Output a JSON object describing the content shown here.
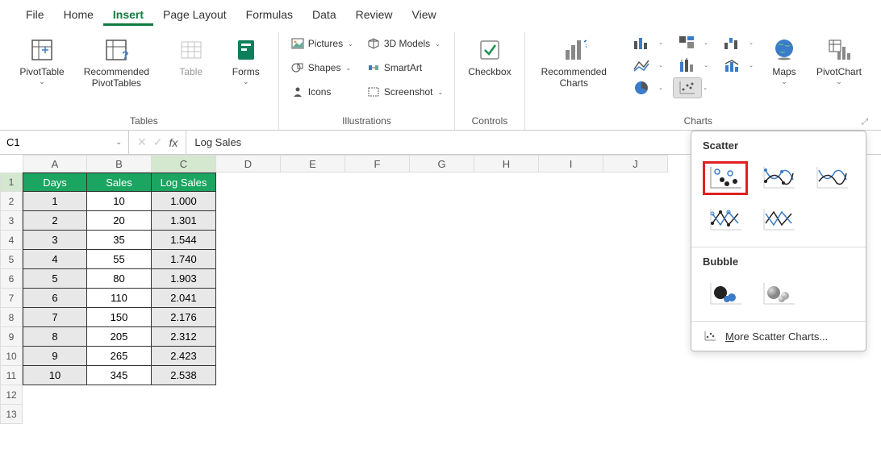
{
  "menu": {
    "tabs": [
      "File",
      "Home",
      "Insert",
      "Page Layout",
      "Formulas",
      "Data",
      "Review",
      "View"
    ],
    "active": "Insert"
  },
  "ribbon": {
    "tables": {
      "label": "Tables",
      "pivot": "PivotTable",
      "recpivot": "Recommended PivotTables",
      "table": "Table",
      "forms": "Forms"
    },
    "illustrations": {
      "label": "Illustrations",
      "pictures": "Pictures",
      "shapes": "Shapes",
      "icons": "Icons",
      "models": "3D Models",
      "smartart": "SmartArt",
      "screenshot": "Screenshot"
    },
    "controls": {
      "label": "Controls",
      "checkbox": "Checkbox"
    },
    "charts": {
      "label": "Charts",
      "rec": "Recommended Charts",
      "maps": "Maps",
      "pivotchart": "PivotChart"
    }
  },
  "namebox": "C1",
  "formula": "Log Sales",
  "columns": [
    "A",
    "B",
    "C",
    "D",
    "E",
    "F",
    "G",
    "H",
    "I",
    "J"
  ],
  "headers": {
    "days": "Days",
    "sales": "Sales",
    "log": "Log Sales"
  },
  "rows": [
    {
      "n": 1,
      "days": "1",
      "sales": "10",
      "log": "1.000"
    },
    {
      "n": 2,
      "days": "2",
      "sales": "20",
      "log": "1.301"
    },
    {
      "n": 3,
      "days": "3",
      "sales": "35",
      "log": "1.544"
    },
    {
      "n": 4,
      "days": "4",
      "sales": "55",
      "log": "1.740"
    },
    {
      "n": 5,
      "days": "5",
      "sales": "80",
      "log": "1.903"
    },
    {
      "n": 6,
      "days": "6",
      "sales": "110",
      "log": "2.041"
    },
    {
      "n": 7,
      "days": "7",
      "sales": "150",
      "log": "2.176"
    },
    {
      "n": 8,
      "days": "8",
      "sales": "205",
      "log": "2.312"
    },
    {
      "n": 9,
      "days": "9",
      "sales": "265",
      "log": "2.423"
    },
    {
      "n": 10,
      "days": "10",
      "sales": "345",
      "log": "2.538"
    }
  ],
  "dropdown": {
    "scatter_title": "Scatter",
    "bubble_title": "Bubble",
    "more": "More Scatter Charts..."
  }
}
